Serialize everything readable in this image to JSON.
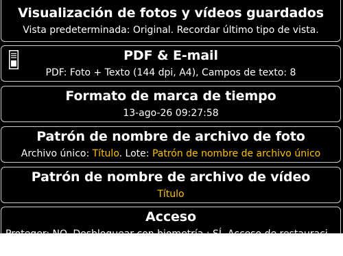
{
  "settings": [
    {
      "title": "Visualización de fotos y vídeos guardados",
      "subtitle": "Vista predeterminada: Original. Recordar último tipo de vista."
    },
    {
      "title": "PDF & E-mail",
      "subtitle": "PDF: Foto + Texto (144 dpi, A4), Campos de texto: 8",
      "icon": "document-icon"
    },
    {
      "title": "Formato de marca de tiempo",
      "subtitle": "13-ago-26 09:27:58"
    },
    {
      "title": "Patrón de nombre de archivo de foto",
      "subtitle_parts": {
        "single_label": "Archivo único: ",
        "single_value": "Título",
        "batch_label": ". Lote: ",
        "batch_value": "Patrón de nombre de archivo único"
      }
    },
    {
      "title": "Patrón de nombre de archivo de vídeo",
      "subtitle_value": "Título"
    },
    {
      "title": "Acceso",
      "subtitle": "Proteger: NO. Desbloquear con biometría : SÍ. Acceso de restauraci"
    }
  ],
  "colors": {
    "background": "#000000",
    "text": "#ffffff",
    "highlight": "#ffc107",
    "border": "#cfcfcf"
  }
}
